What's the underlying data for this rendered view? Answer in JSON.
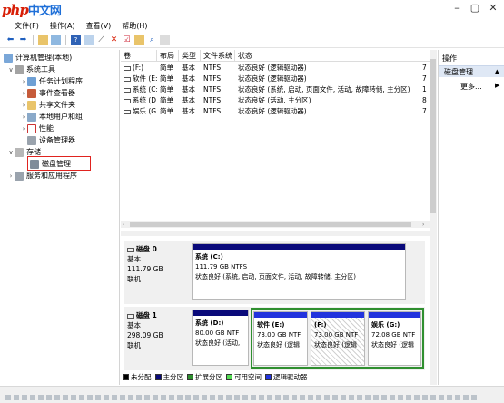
{
  "watermark": {
    "latin": "php",
    "cn": "中文网"
  },
  "menu": [
    "文件(F)",
    "操作(A)",
    "查看(V)",
    "帮助(H)"
  ],
  "tree": {
    "root": "计算机管理(本地)",
    "system_tools": "系统工具",
    "task_scheduler": "任务计划程序",
    "event_viewer": "事件查看器",
    "shared_folders": "共享文件夹",
    "local_users": "本地用户和组",
    "performance": "性能",
    "device_manager": "设备管理器",
    "storage": "存储",
    "disk_management": "磁盘管理",
    "services": "服务和应用程序"
  },
  "volume_table": {
    "headers": [
      "卷",
      "布局",
      "类型",
      "文件系统",
      "状态"
    ],
    "rows": [
      {
        "vol": "(F:)",
        "layout": "简单",
        "type": "基本",
        "fs": "NTFS",
        "status": "状态良好 (逻辑驱动器)",
        "extra": "7"
      },
      {
        "vol": "软件 (E:)",
        "layout": "简单",
        "type": "基本",
        "fs": "NTFS",
        "status": "状态良好 (逻辑驱动器)",
        "extra": "7"
      },
      {
        "vol": "系统 (C:)",
        "layout": "简单",
        "type": "基本",
        "fs": "NTFS",
        "status": "状态良好 (系统, 启动, 页面文件, 活动, 故障转储, 主分区)",
        "extra": "1"
      },
      {
        "vol": "系统 (D:)",
        "layout": "简单",
        "type": "基本",
        "fs": "NTFS",
        "status": "状态良好 (活动, 主分区)",
        "extra": "8"
      },
      {
        "vol": "娱乐 (G:)",
        "layout": "简单",
        "type": "基本",
        "fs": "NTFS",
        "status": "状态良好 (逻辑驱动器)",
        "extra": "7"
      }
    ]
  },
  "disks": [
    {
      "title": "磁盘 0",
      "kind": "基本",
      "size": "111.79 GB",
      "state": "联机",
      "partitions": [
        {
          "name": "系统 (C:)",
          "size": "111.79 GB NTFS",
          "status": "状态良好 (系统, 启动, 页面文件, 活动, 故障转储, 主分区)"
        }
      ]
    },
    {
      "title": "磁盘 1",
      "kind": "基本",
      "size": "298.09 GB",
      "state": "联机",
      "partitions": [
        {
          "name": "系统 (D:)",
          "size": "80.00 GB NTF",
          "status": "状态良好 (活动,"
        },
        {
          "name": "软件 (E:)",
          "size": "73.00 GB NTF",
          "status": "状态良好 (逻辑"
        },
        {
          "name": "(F:)",
          "size": "73.00 GB NTF",
          "status": "状态良好 (逻辑"
        },
        {
          "name": "娱乐 (G:)",
          "size": "72.08 GB NTF",
          "status": "状态良好 (逻辑"
        }
      ]
    }
  ],
  "legend": [
    {
      "label": "未分配",
      "color": "#000000"
    },
    {
      "label": "主分区",
      "color": "#0a0a7a"
    },
    {
      "label": "扩展分区",
      "color": "#2f8f2f"
    },
    {
      "label": "可用空间",
      "color": "#55dd55"
    },
    {
      "label": "逻辑驱动器",
      "color": "#2233dd"
    }
  ],
  "operations": {
    "title": "操作",
    "section": "磁盘管理",
    "more": "更多..."
  },
  "icons": [
    "back-arrow-icon",
    "forward-arrow-icon",
    "up-folder-icon",
    "properties-icon",
    "help-icon",
    "delete-icon",
    "checklist-icon",
    "folder-icon",
    "search-icon"
  ]
}
